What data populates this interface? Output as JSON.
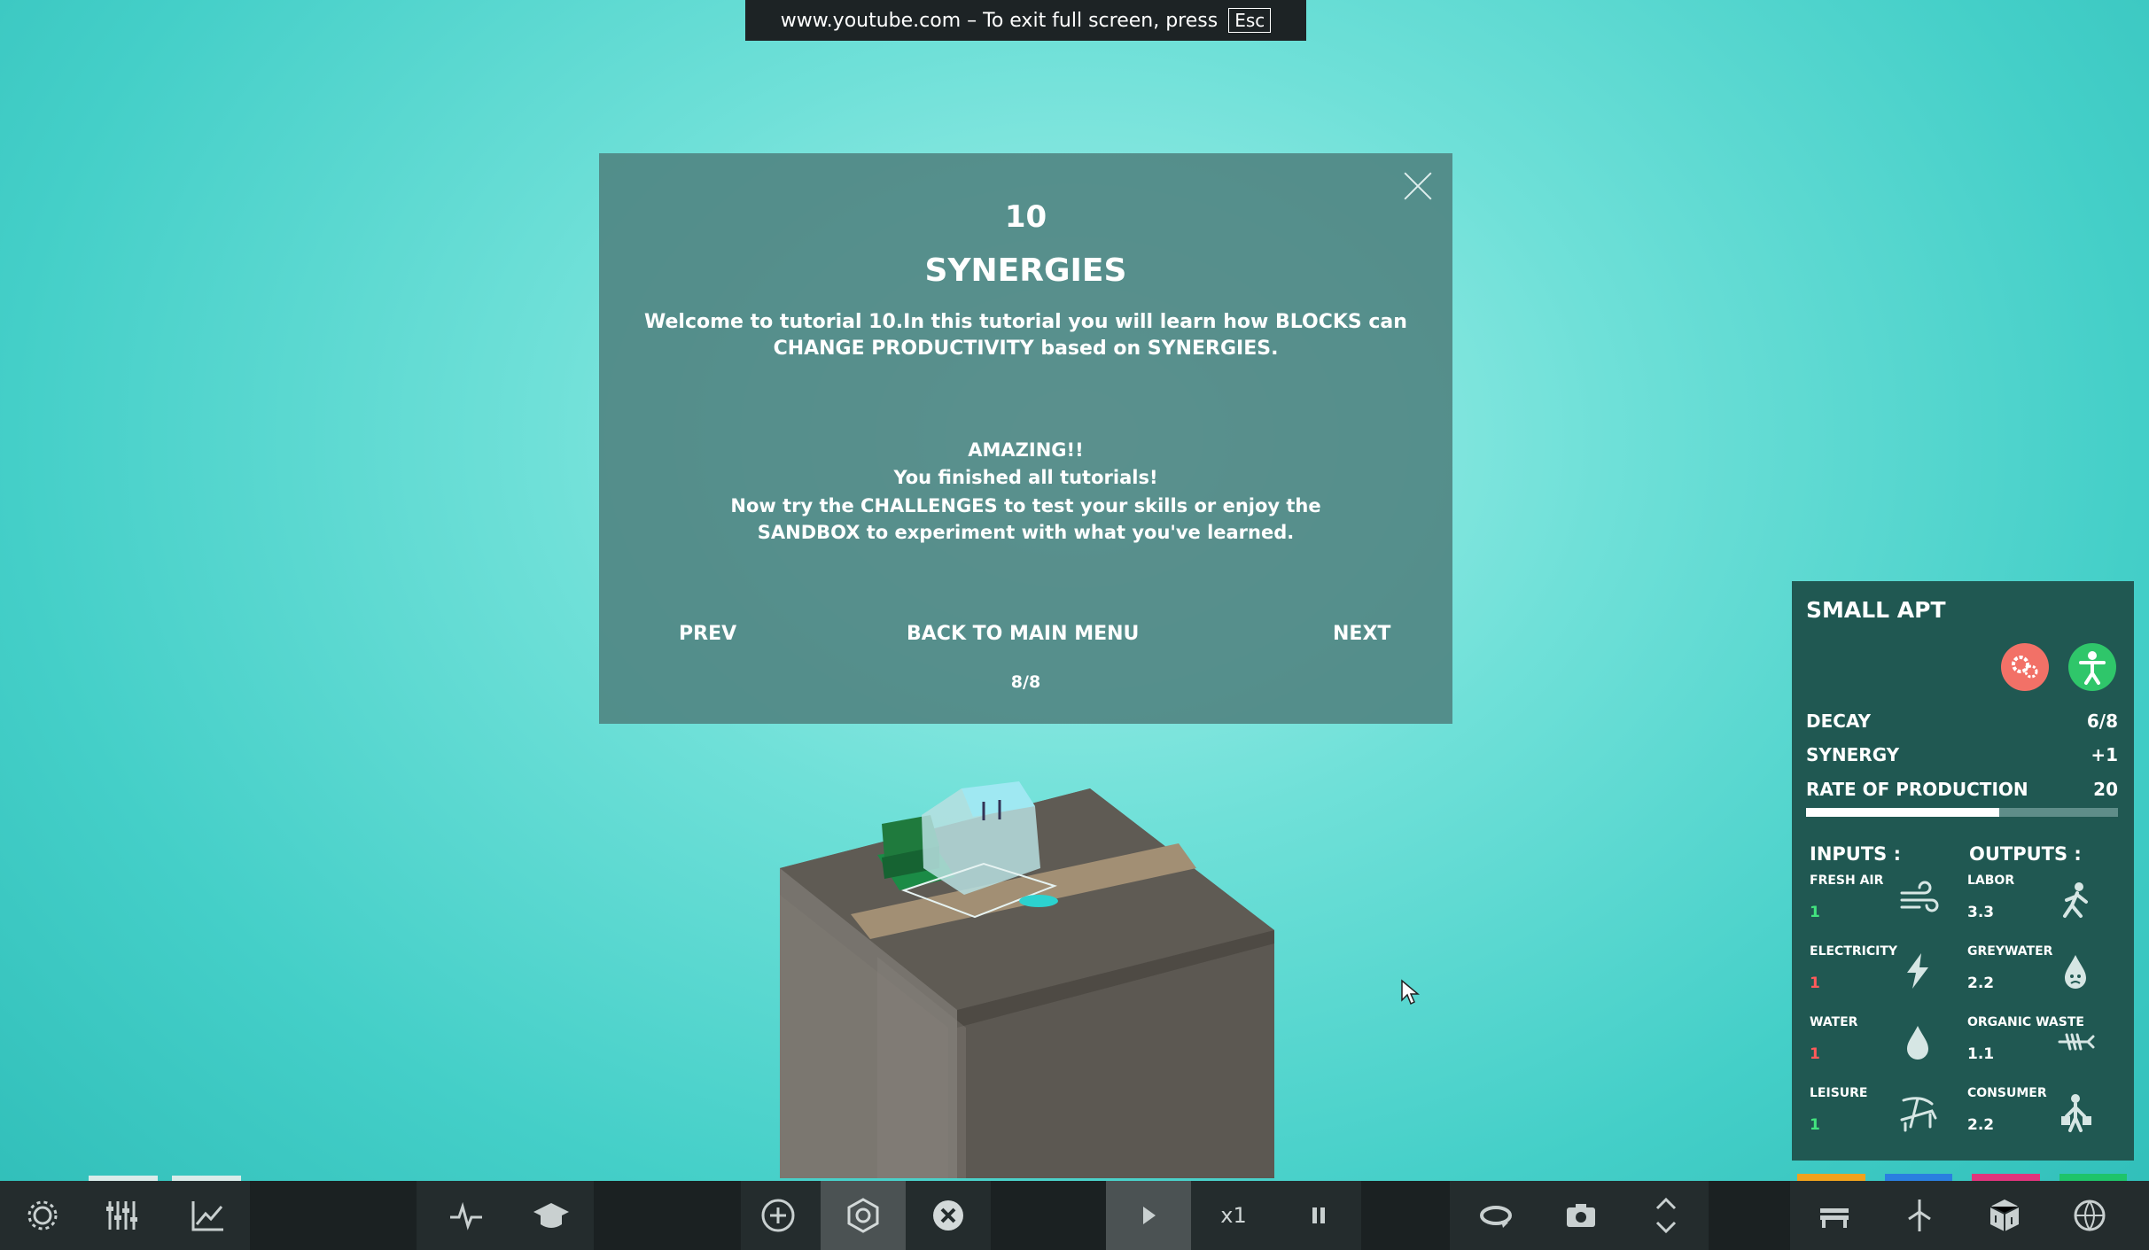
{
  "browser_notice": {
    "text": "www.youtube.com – To exit full screen, press",
    "key": "Esc"
  },
  "tutorial": {
    "number": "10",
    "title": "SYNERGIES",
    "intro": "Welcome to tutorial 10.In this tutorial you will learn how BLOCKS can CHANGE PRODUCTIVITY based on SYNERGIES.",
    "amazing": "AMAZING!!",
    "finished": "You finished all tutorials!",
    "try_text": "Now try the CHALLENGES to test your skills or enjoy the SANDBOX to experiment with what you've learned.",
    "prev_label": "PREV",
    "menu_label": "BACK TO MAIN MENU",
    "next_label": "NEXT",
    "page": "8/8",
    "close_icon": "close-icon"
  },
  "info_panel": {
    "title": "SMALL APT",
    "badges": [
      "gears-icon",
      "person-icon"
    ],
    "decay_label": "DECAY",
    "decay_value": "6/8",
    "synergy_label": "SYNERGY",
    "synergy_value": "+1",
    "rate_label": "RATE OF PRODUCTION",
    "rate_value": "20",
    "rate_progress": 0.62,
    "inputs_label": "INPUTS :",
    "outputs_label": "OUTPUTS :",
    "inputs": [
      {
        "label": "FRESH AIR",
        "value": "1",
        "icon": "wind-icon",
        "color": "#42e37e"
      },
      {
        "label": "ELECTRICITY",
        "value": "1",
        "icon": "lightning-icon",
        "color": "#ff5a5a"
      },
      {
        "label": "WATER",
        "value": "1",
        "icon": "water-drop-icon",
        "color": "#ff5a5a"
      },
      {
        "label": "LEISURE",
        "value": "1",
        "icon": "sun-lounger-icon",
        "color": "#42e37e"
      }
    ],
    "outputs": [
      {
        "label": "LABOR",
        "value": "3.3",
        "icon": "worker-icon"
      },
      {
        "label": "GREYWATER",
        "value": "2.2",
        "icon": "greywater-drop-icon"
      },
      {
        "label": "ORGANIC WASTE",
        "value": "1.1",
        "icon": "fish-bone-icon"
      },
      {
        "label": "CONSUMER",
        "value": "2.2",
        "icon": "shopper-icon"
      }
    ],
    "strip_colors": [
      "#f0a21d",
      "#2a7fe0",
      "#e0347c",
      "#1ec46a"
    ]
  },
  "toolbar": {
    "speed": "x1",
    "buttons": [
      "settings-icon",
      "mixer-icon",
      "chart-icon",
      "pulse-icon",
      "graduation-cap-icon",
      "add-icon",
      "target-icon",
      "remove-icon",
      "play-icon",
      "pause-icon",
      "rotate-icon",
      "camera-icon",
      "chevron-up-icon",
      "chevron-down-icon",
      "bench-icon",
      "wind-turbine-icon",
      "building-icon",
      "globe-icon"
    ]
  }
}
